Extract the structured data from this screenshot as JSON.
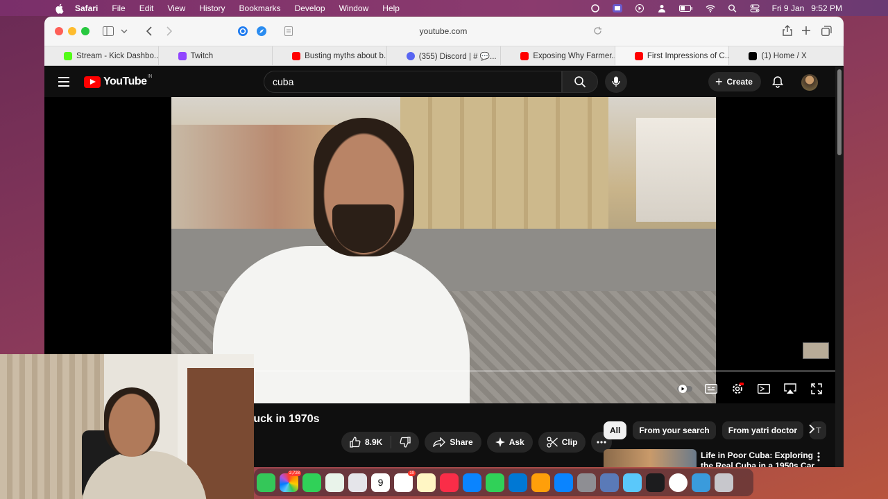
{
  "menubar": {
    "app": "Safari",
    "items": [
      "File",
      "Edit",
      "View",
      "History",
      "Bookmarks",
      "Develop",
      "Window",
      "Help"
    ],
    "date": "Fri 9 Jan",
    "time": "9:52 PM"
  },
  "browser": {
    "address": "youtube.com",
    "tabs": [
      {
        "label": "Stream - Kick Dashbo...",
        "favicon_color": "#53fc18"
      },
      {
        "label": "Twitch",
        "favicon_color": "#9146ff"
      },
      {
        "label": "Busting myths about b...",
        "favicon_color": "#ff0000"
      },
      {
        "label": "(355) Discord | # 💬...",
        "favicon_color": "#5865f2"
      },
      {
        "label": "Exposing Why Farmer...",
        "favicon_color": "#ff0000"
      },
      {
        "label": "First Impressions of C...",
        "favicon_color": "#ff0000"
      },
      {
        "label": "(1) Home / X",
        "favicon_color": "#000000"
      }
    ]
  },
  "youtube": {
    "logo_text": "YouTube",
    "region": "IN",
    "search_value": "cuba",
    "create_label": "Create",
    "video_title": "tuck in 1970s",
    "like_count": "8.9K",
    "share_label": "Share",
    "ask_label": "Ask",
    "clip_label": "Clip",
    "chips": [
      "All",
      "From your search",
      "From yatri doctor",
      "T"
    ],
    "recommendation_title": "Life in Poor Cuba: Exploring the Real Cuba in a 1950s Car"
  },
  "dock": {
    "badges": {
      "photos": "2,728",
      "calendar_day": "9",
      "reminders": "10"
    }
  },
  "colors": {
    "youtube_red": "#ff0000",
    "page_bg": "#0f0f0f",
    "chip_active": "#f1f1f1"
  }
}
